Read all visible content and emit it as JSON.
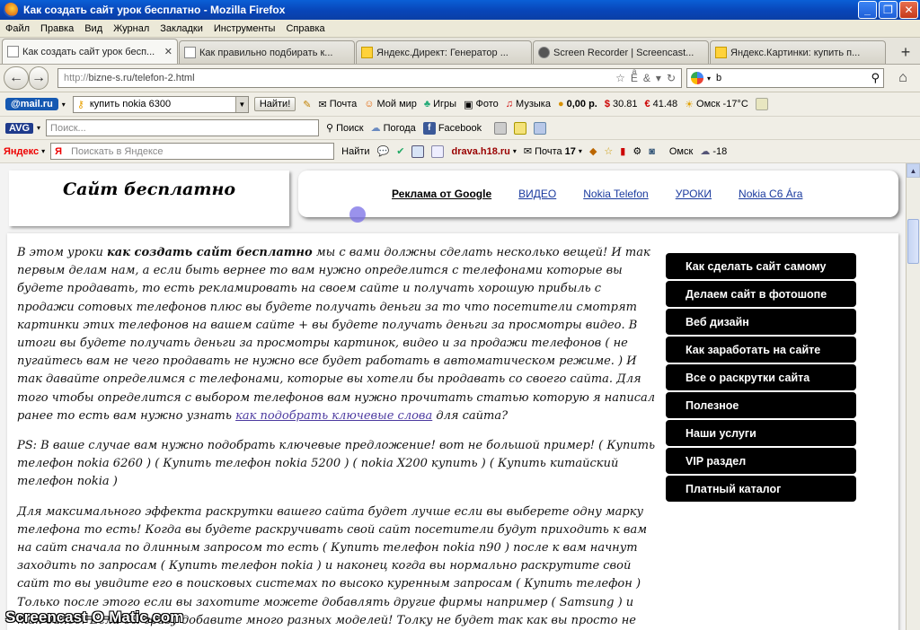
{
  "window": {
    "title": "Как создать сайт урок бесплатно - Mozilla Firefox"
  },
  "menubar": [
    "Файл",
    "Правка",
    "Вид",
    "Журнал",
    "Закладки",
    "Инструменты",
    "Справка"
  ],
  "tabs": [
    {
      "label": "Как создать сайт урок бесп..."
    },
    {
      "label": "Как правильно подбирать к..."
    },
    {
      "label": "Яндекс.Директ: Генератор ..."
    },
    {
      "label": "Screen Recorder | Screencast..."
    },
    {
      "label": "Яндекс.Картинки: купить п..."
    }
  ],
  "nav": {
    "url_scheme": "http://",
    "url_rest": "bizne-s.ru/telefon-2.html",
    "search_value": "b"
  },
  "toolbar1": {
    "logo": "@mail.ru",
    "combo_value": "купить nokia 6300",
    "find": "Найти!",
    "items": [
      "Почта",
      "Мой мир",
      "Игры",
      "Фото",
      "Музыка"
    ],
    "money": "0,00 р.",
    "usd": "30.81",
    "eur": "41.48",
    "weather": "Омск -17°С"
  },
  "toolbar2": {
    "logo": "AVG",
    "placeholder": "Поиск...",
    "search": "Поиск",
    "weather": "Погода",
    "facebook": "Facebook"
  },
  "toolbar3": {
    "logo": "Яндекс",
    "placeholder": "Поискать в Яндексе",
    "find": "Найти",
    "site": "drava.h18.ru",
    "mail": "Почта",
    "mail_count": "17",
    "city": "Омск",
    "temp": "-18"
  },
  "page": {
    "site_title": "Сайт бесплатно",
    "ad_label": "Реклама от Google",
    "ad_links": [
      "ВИДЕО",
      "Nokia Telefon",
      "УРОКИ",
      "Nokia C6 Ára"
    ],
    "p1_a": "В этом уроки ",
    "p1_bold": "как создать сайт бесплатно",
    "p1_b": " мы с вами должны сделать несколько вещей! И так первым делам нам, а если быть вернее то вам нужно определится с телефонами которые вы будете продавать, то есть рекламировать на своем сайте и получать хорошую прибыль с продажи сотовых телефонов плюс вы будете получать деньги за то что посетители смотрят картинки этих телефонов на вашем сайте + вы будете получать деньги за просмотры видео. В итоги вы будете получать деньги за просмотры картинок, видео и за продажи телефонов ( не пугайтесь вам не чего продавать не нужно все будет работать в автоматическом режиме. ) И так давайте определимся с телефонами, которые вы хотели бы продавать со своего сайта. Для того чтобы определится с выбором телефонов вам нужно прочитать статью которую я написал ранее то есть вам нужно узнать ",
    "p1_link": "как подобрать ключевые слова",
    "p1_c": " для сайта?",
    "p2": "PS: В ваше случае вам нужно подобрать ключевые предложение! вот не большой пример! ( Купить телефон nokia 6260 ) ( Купить телефон nokia 5200 ) ( nokia X200 купить ) ( Купить китайский телефон nokia )",
    "p3": "Для максимального эффекта раскрутки вашего сайта будет лучше если вы выберете одну марку телефона то есть! Когда вы будете раскручивать свой сайт посетители будут приходить к вам на сайт сначала по длинным запросом то есть ( Купить телефон nokia n90 ) после к вам начнут заходить по запросам ( Купить телефон nokia ) и наконец когда вы нормально раскрутите свой сайт то вы увидите его в поисковых системах по высоко куренным запросам ( Купить телефон ) Только после этого если вы захотите можете добавлять другие фирмы например ( Samsung ) и так далее! Если вы сразу добавите много разных моделей! Толку не будет так как вы просто не сможете",
    "menu": [
      "Как сделать сайт самому",
      "Делаем сайт в фотошопе",
      "Веб дизайн",
      "Как заработать на сайте",
      "Все о раскрутки сайта",
      "Полезное",
      "Наши услуги",
      "VIP раздел",
      "Платный каталог"
    ]
  },
  "watermark": "Screencast-O-Matic.com"
}
